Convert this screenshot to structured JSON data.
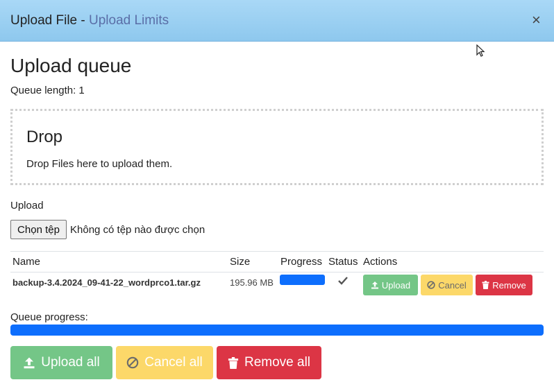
{
  "header": {
    "title": "Upload File",
    "separator": " - ",
    "link": "Upload Limits",
    "close_label": "×"
  },
  "queue": {
    "title": "Upload queue",
    "length_text": "Queue length: 1"
  },
  "dropzone": {
    "title": "Drop",
    "text": "Drop Files here to upload them."
  },
  "upload": {
    "label": "Upload",
    "choose_button": "Chọn tệp",
    "no_file_text": "Không có tệp nào được chọn"
  },
  "table": {
    "columns": [
      "Name",
      "Size",
      "Progress",
      "Status",
      "Actions"
    ],
    "rows": [
      {
        "name": "backup-3.4.2024_09-41-22_wordprco1.tar.gz",
        "size": "195.96 MB",
        "progress": 1.0,
        "status_icon": "check-icon",
        "actions": {
          "upload": "Upload",
          "cancel": "Cancel",
          "remove": "Remove"
        }
      }
    ]
  },
  "queue_progress": {
    "label": "Queue progress:",
    "value": 1.0
  },
  "footer_buttons": {
    "upload_all": "Upload all",
    "cancel_all": "Cancel all",
    "remove_all": "Remove all"
  },
  "colors": {
    "header_bg": "#a9d8f6",
    "link": "#5a6ea7",
    "success": "#74c687",
    "warning": "#fcd869",
    "danger": "#dc3545",
    "progress": "#0d6efd"
  }
}
